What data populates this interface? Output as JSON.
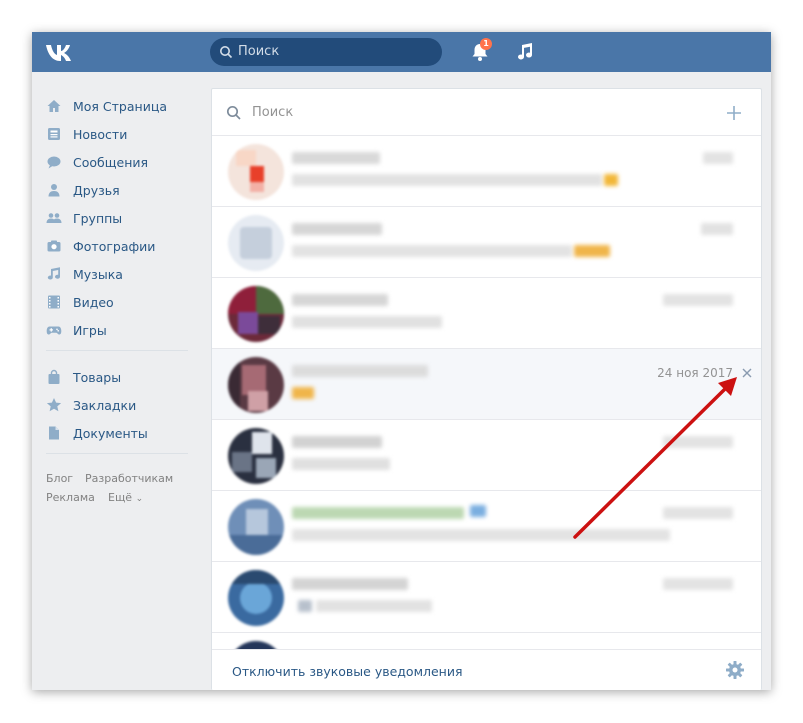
{
  "topbar": {
    "logo": "VK",
    "search_placeholder": "Поиск",
    "notification_count": "1"
  },
  "sidebar": {
    "items": [
      {
        "label": "Моя Страница",
        "icon": "home-icon"
      },
      {
        "label": "Новости",
        "icon": "news-icon"
      },
      {
        "label": "Сообщения",
        "icon": "messages-icon"
      },
      {
        "label": "Друзья",
        "icon": "friends-icon"
      },
      {
        "label": "Группы",
        "icon": "groups-icon"
      },
      {
        "label": "Фотографии",
        "icon": "camera-icon"
      },
      {
        "label": "Музыка",
        "icon": "music-icon"
      },
      {
        "label": "Видео",
        "icon": "video-icon"
      },
      {
        "label": "Игры",
        "icon": "games-icon"
      }
    ],
    "items2": [
      {
        "label": "Товары",
        "icon": "bag-icon"
      },
      {
        "label": "Закладки",
        "icon": "star-icon"
      },
      {
        "label": "Документы",
        "icon": "document-icon"
      }
    ],
    "footer": {
      "blog": "Блог",
      "developers": "Разработчикам",
      "ads": "Реклама",
      "more": "Ещё"
    }
  },
  "messages": {
    "search_placeholder": "Поиск",
    "highlighted_date": "24 ноя 2017",
    "mute_label": "Отключить звуковые уведомления"
  },
  "colors": {
    "brand": "#4a76a8",
    "link": "#2a5885",
    "arrow": "#cc1111",
    "badge": "#ff734c"
  }
}
